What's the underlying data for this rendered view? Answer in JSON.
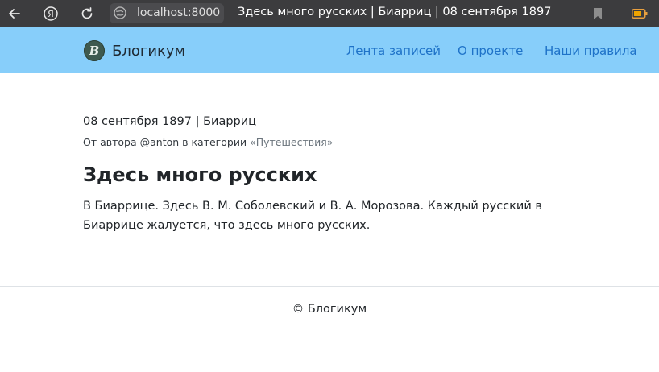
{
  "browser": {
    "address": "localhost:8000",
    "tab_title": "Здесь много русских | Биарриц | 08 сентября 1897",
    "icons": [
      "back-icon",
      "yandex-icon",
      "reload-icon",
      "globe-icon",
      "bookmark-icon",
      "battery-icon"
    ]
  },
  "navbar": {
    "brand_letter": "B",
    "brand_name": "Блогикум",
    "links": [
      {
        "label": "Лента записей"
      },
      {
        "label": "О проекте"
      },
      {
        "label": "Наши правила"
      }
    ],
    "background": "#87cefa",
    "link_color": "#1e72c8"
  },
  "post": {
    "meta": "08 сентября 1897 | Биарриц",
    "author_prefix": "От автора @anton в категории ",
    "category": "«Путешествия»",
    "title": "Здесь много русских",
    "body": "В Биаррице. Здесь В. М. Соболевский и В. А. Морозова. Каждый русский в Биаррице жалуется, что здесь много русских."
  },
  "footer": {
    "text": "© Блогикум"
  }
}
